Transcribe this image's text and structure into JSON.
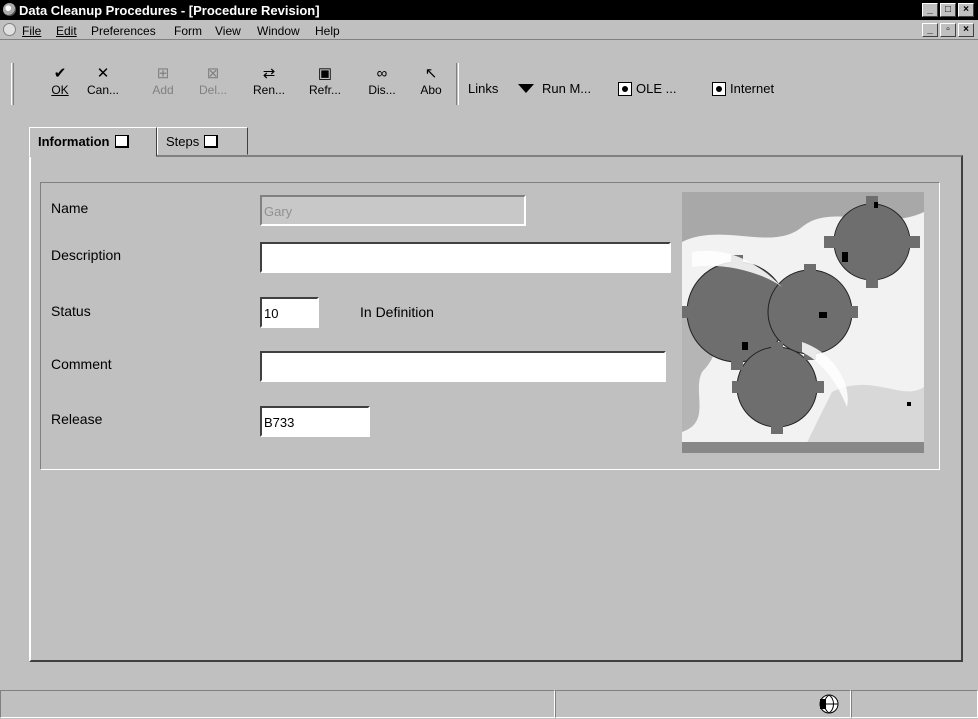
{
  "window": {
    "title": "Data Cleanup Procedures - [Procedure Revision]"
  },
  "menu": {
    "file": "File",
    "edit": "Edit",
    "preferences": "Preferences",
    "form": "Form",
    "view": "View",
    "window": "Window",
    "help": "Help"
  },
  "toolbar": {
    "ok": "OK",
    "cancel": "Can...",
    "add": "Add",
    "delete": "Del...",
    "rename": "Ren...",
    "refresh": "Refr...",
    "display": "Dis...",
    "about": "Abo",
    "links": "Links",
    "run": "Run M...",
    "ole": "OLE ...",
    "internet": "Internet"
  },
  "tabs": {
    "information": "Information",
    "steps": "Steps"
  },
  "form": {
    "name_label": "Name",
    "name_value": "Gary",
    "description_label": "Description",
    "description_value": "",
    "status_label": "Status",
    "status_value": "10",
    "status_text": "In Definition",
    "comment_label": "Comment",
    "comment_value": "",
    "release_label": "Release",
    "release_value": "B733"
  }
}
